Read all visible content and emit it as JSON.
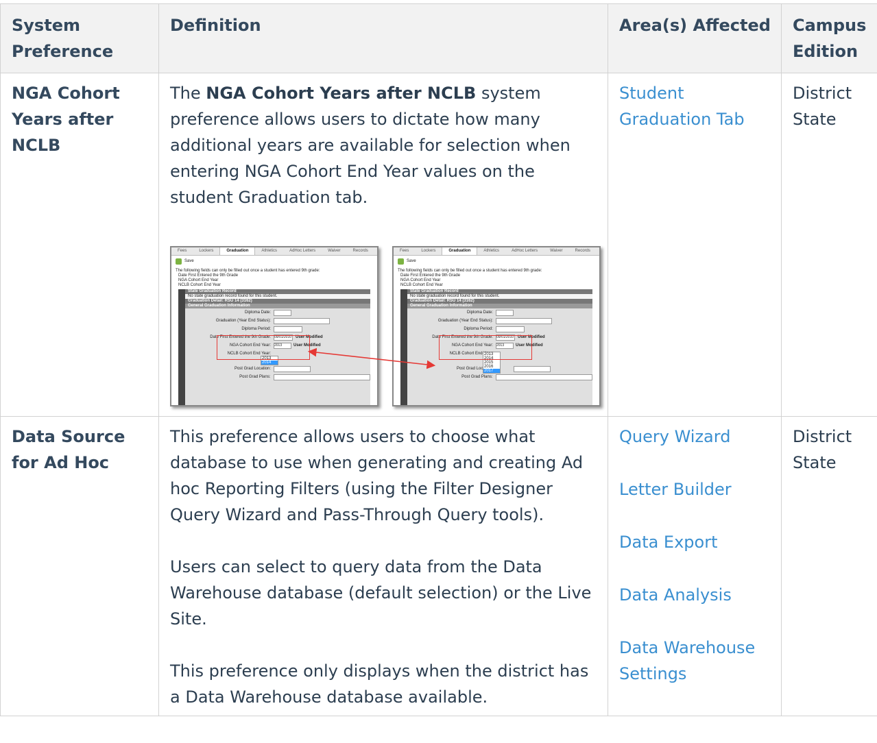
{
  "headers": {
    "preference": "System Preference",
    "definition": "Definition",
    "areas": "Area(s) Affected",
    "edition": "Campus Edition"
  },
  "rows": [
    {
      "preference": "NGA Cohort Years after NCLB",
      "definition_pre": "The ",
      "definition_bold": "NGA Cohort Years after NCLB",
      "definition_post": " system preference allows users to dictate how many additional years are available for selection when entering NGA Cohort End Year values on the student Graduation tab.",
      "areas": [
        "Student Graduation Tab"
      ],
      "edition": [
        "District",
        "State"
      ]
    },
    {
      "preference": "Data Source for Ad Hoc",
      "definition": [
        "This preference allows users to choose what database to use when generating and creating Ad hoc Reporting Filters (using the Filter Designer Query Wizard and Pass-Through Query tools).",
        "Users can select to query data from the Data Warehouse database (default selection) or the Live Site.",
        "This preference only displays when the district has a Data Warehouse database available."
      ],
      "areas": [
        "Query Wizard",
        "Letter Builder",
        "Data Export",
        "Data Analysis",
        "Data Warehouse Settings"
      ],
      "edition": [
        "District",
        "State"
      ]
    }
  ],
  "screenshot": {
    "tabs": [
      "Fees",
      "Lockers",
      "Graduation",
      "Athletics",
      "AdHoc Letters",
      "Waiver",
      "Records"
    ],
    "save": "Save",
    "note_lines": [
      "The following fields can only be filled out once a student has entered 9th grade:",
      "Date First Entered the 9th Grade",
      "NGA Cohort End Year",
      "NCLB Cohort End Year"
    ],
    "state_grad_record": "State Graduation Record",
    "no_record": "No state graduation record found for this student.",
    "grad_detail": "Graduation Detail: RSU 14 (3162)",
    "general_info": "General Graduation Information",
    "diploma_date": "Diploma Date:",
    "graduation_status": "Graduation (Year End Status):",
    "diploma_period": "Diploma Period:",
    "date_first_entered": "Date First Entered the 9th Grade:",
    "date_value": "09/01/2010",
    "user_modified": "User Modified",
    "nga_label": "NGA Cohort End Year:",
    "nga_value": "2013",
    "nclb_label": "NCLB Cohort End Year:",
    "post_grad_location": "Post Grad Location:",
    "post_grad_plans": "Post Grad Plans:",
    "left_options": [
      "2013",
      "2014"
    ],
    "right_options": [
      "2013",
      "2014",
      "2015",
      "2016",
      "2017"
    ]
  }
}
